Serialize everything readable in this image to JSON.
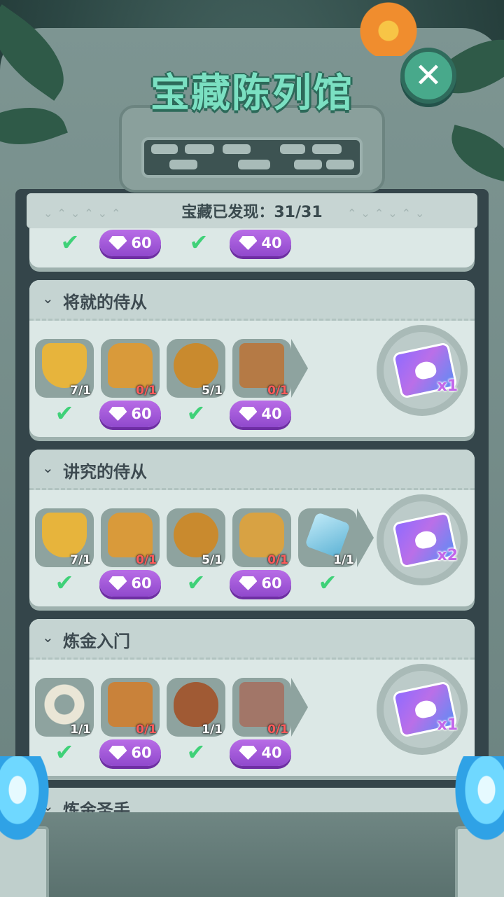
{
  "header": {
    "title": "宝藏陈列馆",
    "close_icon": "close-icon"
  },
  "progress": {
    "label": "宝藏已发现：31/31"
  },
  "top_partial": {
    "gems": [
      "60",
      "40"
    ]
  },
  "sections": [
    {
      "title": "将就的侍从",
      "items": [
        {
          "icon": "mickey-shield-icon",
          "count": "7/1",
          "done": true
        },
        {
          "icon": "armor-icon",
          "count": "0/1",
          "done": false,
          "cost": "60"
        },
        {
          "icon": "belt-icon",
          "count": "5/1",
          "done": true
        },
        {
          "icon": "boots-icon",
          "count": "0/1",
          "done": false,
          "cost": "40"
        }
      ],
      "reward": {
        "icon": "mickey-card-icon",
        "qty": "x1"
      }
    },
    {
      "title": "讲究的侍从",
      "items": [
        {
          "icon": "mickey-shield-icon",
          "count": "7/1",
          "done": true
        },
        {
          "icon": "armor-icon",
          "count": "0/1",
          "done": false,
          "cost": "60"
        },
        {
          "icon": "belt-icon",
          "count": "5/1",
          "done": true
        },
        {
          "icon": "mickey-medallion-icon",
          "count": "0/1",
          "done": false,
          "cost": "60"
        },
        {
          "icon": "crystal-sword-icon",
          "count": "1/1",
          "done": true
        }
      ],
      "reward": {
        "icon": "mickey-cards-icon",
        "qty": "x2"
      }
    },
    {
      "title": "炼金入门",
      "items": [
        {
          "icon": "bone-ring-icon",
          "count": "1/1",
          "done": true
        },
        {
          "icon": "tiki-mask-icon",
          "count": "0/1",
          "done": false,
          "cost": "60"
        },
        {
          "icon": "tribal-shield-icon",
          "count": "1/1",
          "done": true
        },
        {
          "icon": "stone-tablet-icon",
          "count": "0/1",
          "done": false,
          "cost": "40"
        }
      ],
      "reward": {
        "icon": "mickey-card-icon",
        "qty": "x1"
      }
    }
  ],
  "next_section": {
    "title": "炼金圣手"
  },
  "colors": {
    "gem_button": "#9d56d8",
    "check": "#3fd178",
    "title_text": "#7be0c2",
    "missing_count": "#ff5b5b"
  }
}
